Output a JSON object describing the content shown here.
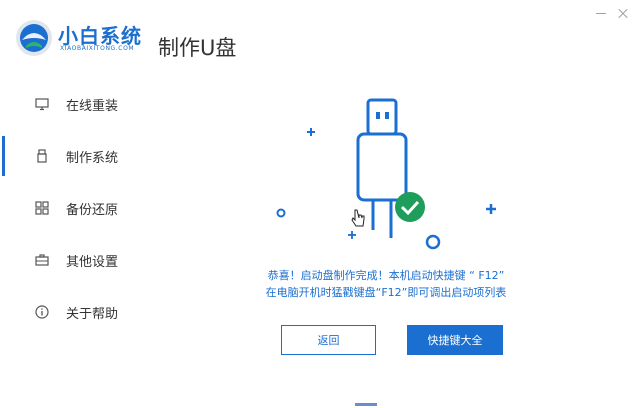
{
  "brand": {
    "name": "小白系统",
    "subtitle": "XIAOBAIXITONG.COM"
  },
  "header": {
    "title": "制作U盘"
  },
  "sidebar": {
    "items": [
      {
        "label": "在线重装",
        "icon": "monitor-icon",
        "active": false
      },
      {
        "label": "制作系统",
        "icon": "usb-icon",
        "active": true
      },
      {
        "label": "备份还原",
        "icon": "grid-icon",
        "active": false
      },
      {
        "label": "其他设置",
        "icon": "briefcase-icon",
        "active": false
      },
      {
        "label": "关于帮助",
        "icon": "info-icon",
        "active": false
      }
    ]
  },
  "main": {
    "message_line1": "恭喜！启动盘制作完成！本机启动快捷键 “ F12”",
    "message_line2": "在电脑开机时猛戳键盘“F12”即可调出启动项列表",
    "back_button": "返回",
    "hotkey_button": "快捷键大全"
  },
  "colors": {
    "accent": "#1b6fd0",
    "success": "#1e9e5a"
  }
}
